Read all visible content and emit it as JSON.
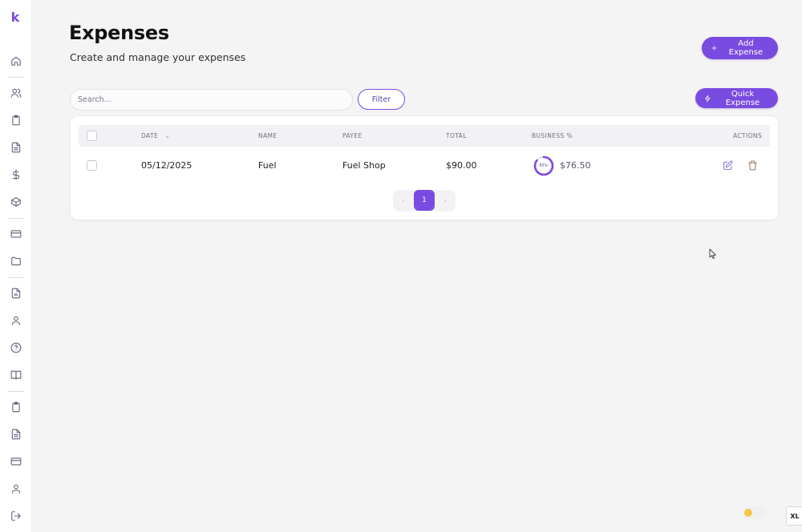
{
  "brand": {
    "logo_text": "k",
    "accent": "#7a4be0"
  },
  "sidebar": {
    "items": [
      {
        "icon": "home-icon"
      },
      {
        "icon": "users-icon"
      },
      {
        "icon": "clipboard-icon"
      },
      {
        "icon": "document-icon"
      },
      {
        "icon": "dollar-icon"
      },
      {
        "icon": "box-icon"
      },
      {
        "icon": "credit-card-icon"
      },
      {
        "icon": "folder-icon"
      },
      {
        "icon": "report-icon"
      },
      {
        "icon": "user-icon"
      },
      {
        "icon": "help-icon"
      },
      {
        "icon": "book-icon"
      },
      {
        "icon": "clipboard-icon"
      },
      {
        "icon": "document-icon"
      },
      {
        "icon": "credit-card-icon"
      },
      {
        "icon": "user-icon"
      },
      {
        "icon": "logout-icon"
      }
    ]
  },
  "header": {
    "title": "Expenses",
    "subtitle": "Create and manage your expenses",
    "add_expense_label": "Add Expense",
    "quick_expense_label": "Quick Expense"
  },
  "toolbar": {
    "search_placeholder": "Search...",
    "filter_label": "Filter"
  },
  "table": {
    "columns": {
      "date": "DATE",
      "name": "NAME",
      "payee": "PAYEE",
      "total": "TOTAL",
      "business": "BUSINESS %",
      "actions": "ACTIONS"
    },
    "rows": [
      {
        "date": "05/12/2025",
        "name": "Fuel",
        "payee": "Fuel Shop",
        "total": "$90.00",
        "business_percent_label": "85%",
        "business_percent": 85,
        "business_amount": "$76.50"
      }
    ]
  },
  "pagination": {
    "current": "1",
    "prev": "‹",
    "next": "›"
  },
  "footer": {
    "size_badge": "XL"
  }
}
